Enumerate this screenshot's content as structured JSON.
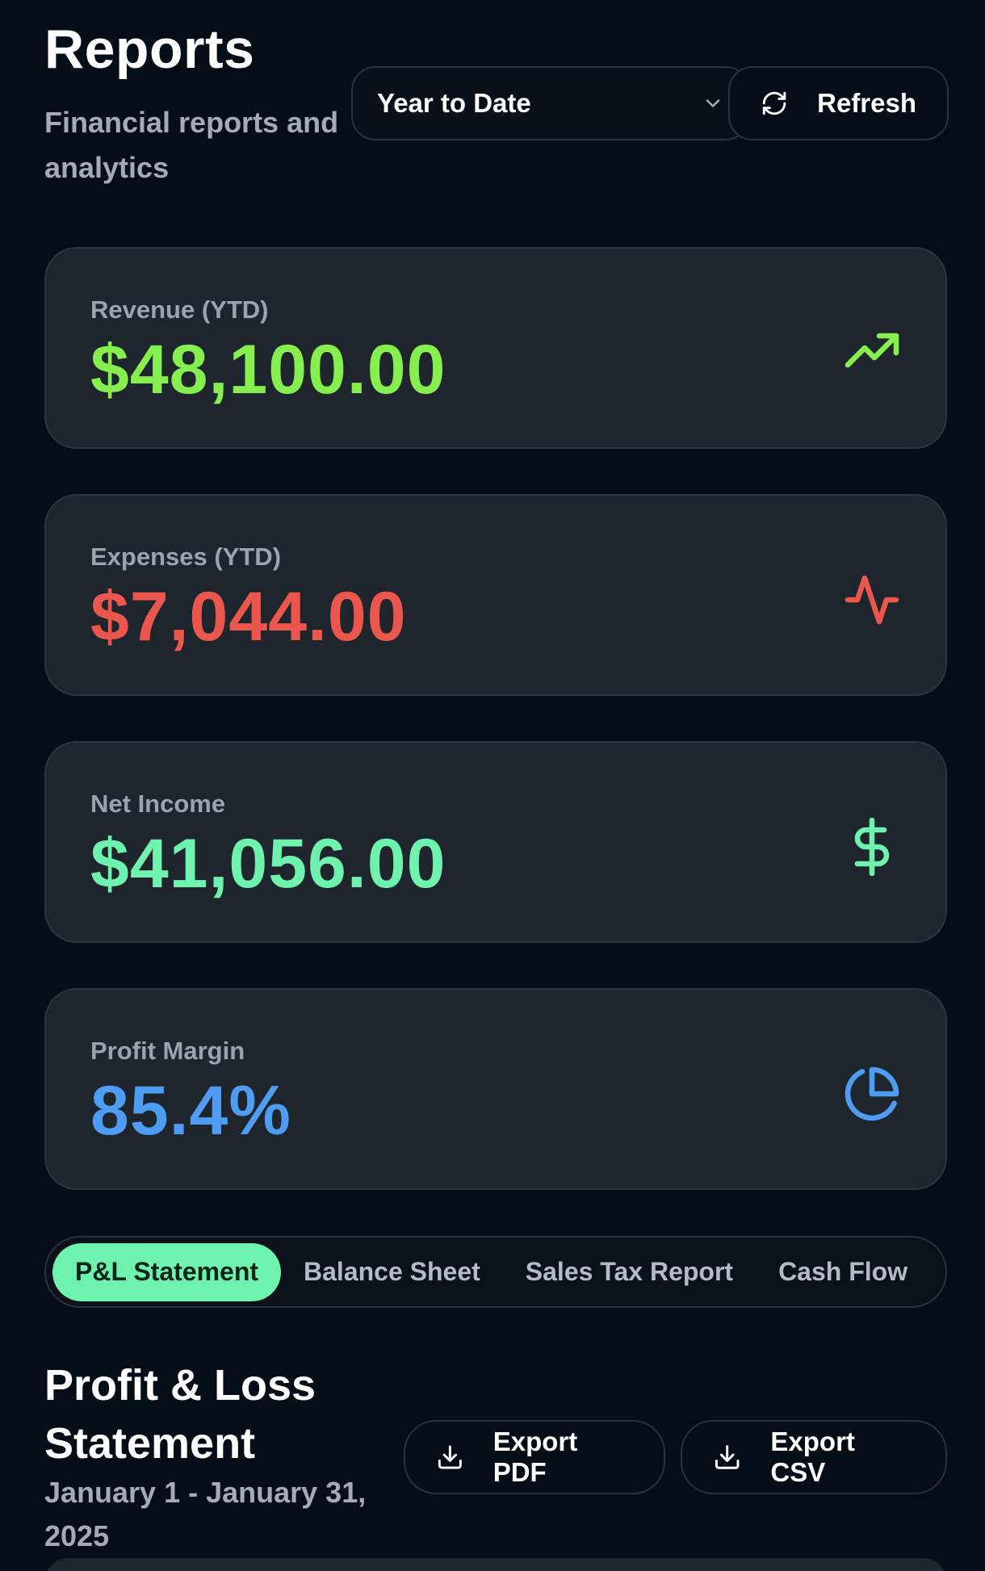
{
  "header": {
    "title": "Reports",
    "subtitle": "Financial reports and analytics",
    "range_select": {
      "value": "Year to Date",
      "icon": "chevron-down-icon"
    },
    "refresh_label": "Refresh"
  },
  "stats": [
    {
      "label": "Revenue (YTD)",
      "value": "$48,100.00",
      "color": "#86ee4f",
      "icon": "trending-up-icon"
    },
    {
      "label": "Expenses (YTD)",
      "value": "$7,044.00",
      "color": "#ec574d",
      "icon": "activity-icon"
    },
    {
      "label": "Net Income",
      "value": "$41,056.00",
      "color": "#6ef2ae",
      "icon": "dollar-icon"
    },
    {
      "label": "Profit Margin",
      "value": "85.4%",
      "color": "#4f9df2",
      "icon": "pie-chart-icon"
    }
  ],
  "tabs": [
    {
      "label": "P&L Statement",
      "active": true
    },
    {
      "label": "Balance Sheet",
      "active": false
    },
    {
      "label": "Sales Tax Report",
      "active": false
    },
    {
      "label": "Cash Flow",
      "active": false
    }
  ],
  "section": {
    "title": "Profit & Loss Statement",
    "date_range": "January 1 - January 31, 2025",
    "export_pdf_label": "Export PDF",
    "export_csv_label": "Export CSV"
  },
  "colors": {
    "background": "#050d16",
    "card": "#1e252d",
    "accent": "#6ef2ae"
  }
}
